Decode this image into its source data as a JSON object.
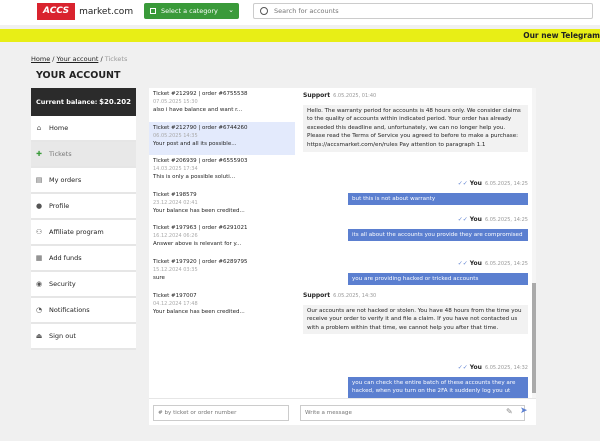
{
  "header": {
    "logo_box": "ACCS",
    "logo_text": "market.com",
    "category_label": "Select a category",
    "search_placeholder": "Search for accounts",
    "ticker": "Our new Telegram"
  },
  "breadcrumb": {
    "home": "Home",
    "account": "Your account",
    "current": "Tickets"
  },
  "page_title": "YOUR ACCOUNT",
  "sidebar": {
    "balance_label": "Current balance:",
    "balance_value": "$20.202",
    "items": [
      {
        "label": "Home",
        "icon": "home-icon"
      },
      {
        "label": "Tickets",
        "icon": "ticket-icon"
      },
      {
        "label": "My orders",
        "icon": "orders-icon"
      },
      {
        "label": "Profile",
        "icon": "profile-icon"
      },
      {
        "label": "Affiliate program",
        "icon": "affiliate-icon"
      },
      {
        "label": "Add funds",
        "icon": "funds-icon"
      },
      {
        "label": "Security",
        "icon": "security-icon"
      },
      {
        "label": "Notifications",
        "icon": "bell-icon"
      },
      {
        "label": "Sign out",
        "icon": "signout-icon"
      }
    ],
    "active_index": 1
  },
  "tickets": [
    {
      "title": "Ticket #212992 | order #6755538",
      "date": "07.05.2025 15:30",
      "preview": "also i have balance and want r..."
    },
    {
      "title": "Ticket #212790 | order #6744260",
      "date": "06.05.2025 14:35",
      "preview": "Your post and all its possible..."
    },
    {
      "title": "Ticket #206939 | order #6555903",
      "date": "14.03.2025 17:34",
      "preview": "This is only a possible soluti..."
    },
    {
      "title": "Ticket #198579",
      "date": "23.12.2024 02:41",
      "preview": "Your balance has been credited..."
    },
    {
      "title": "Ticket #197963 | order #6291021",
      "date": "16.12.2024 06:26",
      "preview": "Answer above is relevant for y..."
    },
    {
      "title": "Ticket #197920 | order #6289795",
      "date": "15.12.2024 03:35",
      "preview": "sure"
    },
    {
      "title": "Ticket #197007",
      "date": "04.12.2024 17:48",
      "preview": "Your balance has been credited..."
    }
  ],
  "selected_ticket": 1,
  "chat": {
    "support_name": "Support",
    "you_name": "You",
    "messages": [
      {
        "from": "support",
        "time": "6.05.2025, 01:40",
        "text": "Hello. The warranty period for accounts is 48 hours only. We consider claims to the quality of accounts within indicated period. Your order has already exceeded this deadline and, unfortunately, we can no longer help you. Please read the Terms of Service you agreed to before to make a purchase: https://accsmarket.com/en/rules Pay attention to paragraph 1.1"
      },
      {
        "from": "you",
        "time": "6.05.2025, 14:25",
        "text": "but this is not about warranty"
      },
      {
        "from": "you",
        "time": "6.05.2025, 14:25",
        "text": "its all about the accounts you provide they are compromised"
      },
      {
        "from": "you",
        "time": "6.05.2025, 14:25",
        "text": "you are providing hacked or tricked accounts"
      },
      {
        "from": "support",
        "time": "6.05.2025, 14:30",
        "text": "Our accounts are not hacked or stolen. You have 48 hours from the time you receive your order to verify it and file a claim. If you have not contacted us with a problem within that time, we cannot help you after that time."
      },
      {
        "from": "you",
        "time": "6.05.2025, 14:32",
        "text": "you can check the entire batch of these accounts they are hacked, when you turn on the 2FA it suddenly log you ut"
      }
    ]
  },
  "footer": {
    "ticket_search_placeholder": "# by ticket or order number",
    "compose_placeholder": "Write a message"
  }
}
